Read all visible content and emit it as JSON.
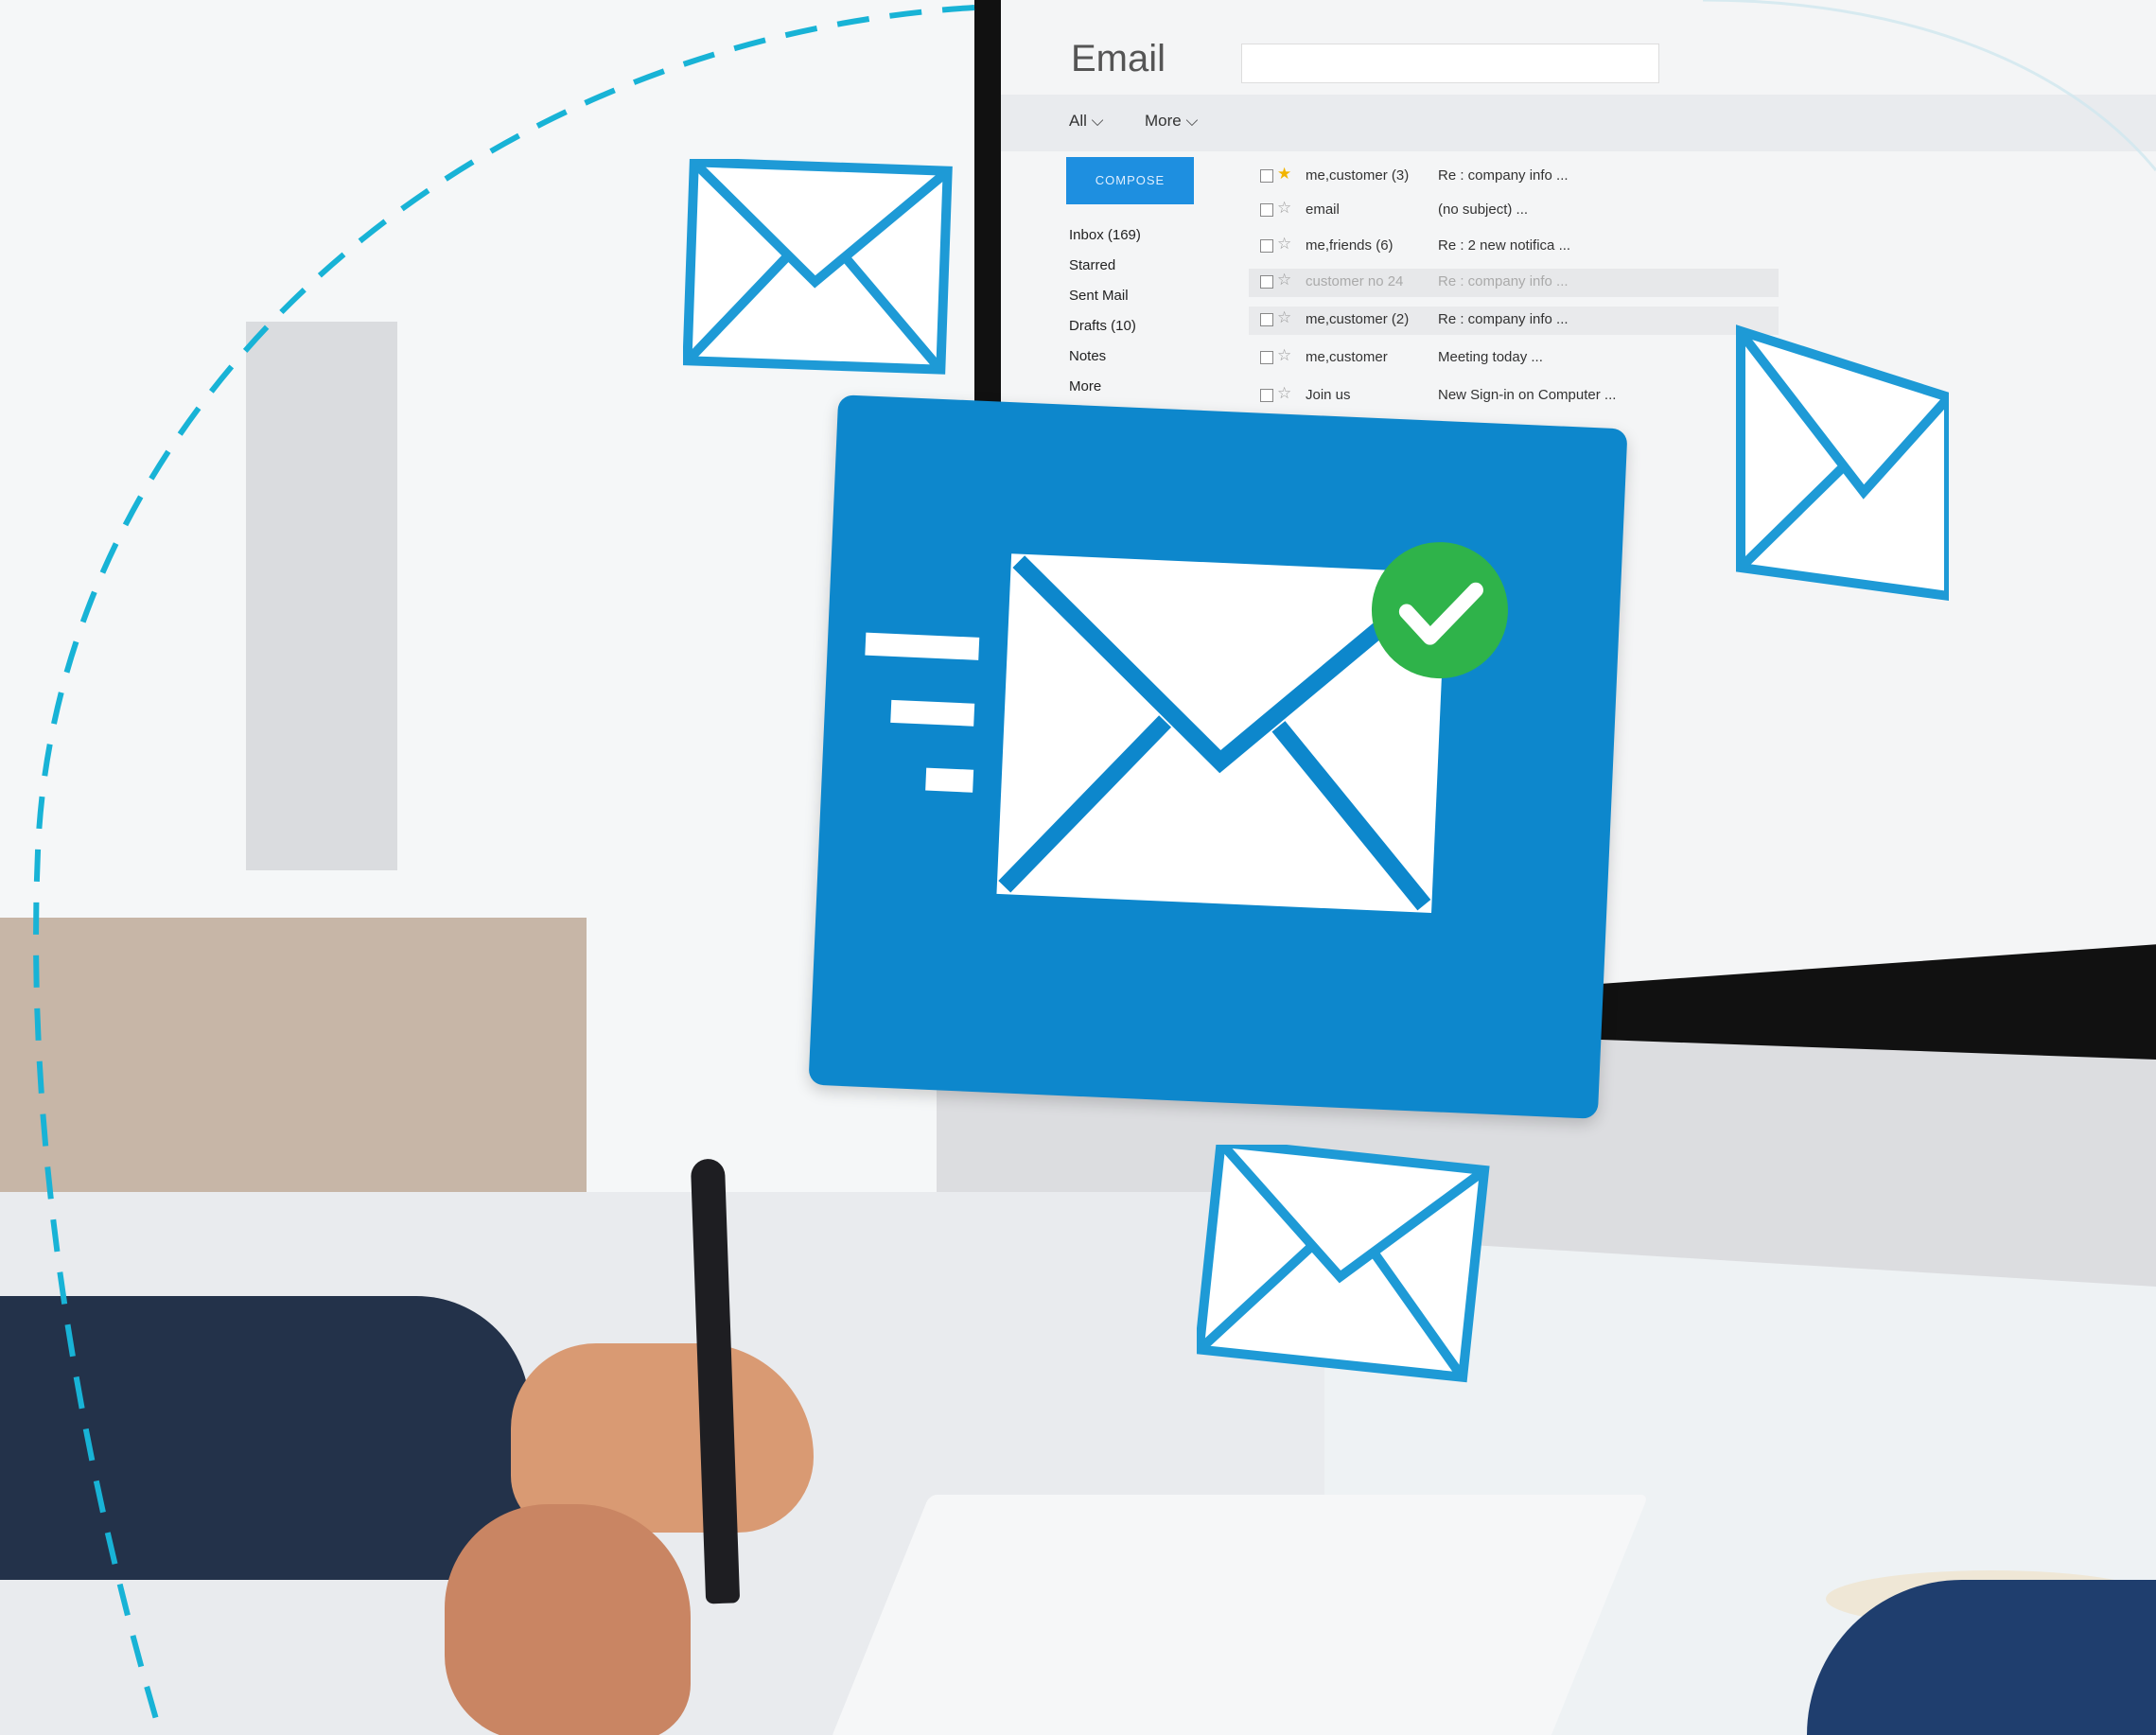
{
  "email_app": {
    "title": "Email",
    "toolbar": {
      "all": "All ⌵",
      "more": "More ⌵"
    },
    "compose_label": "COMPOSE",
    "folders": [
      {
        "label": "Inbox (169)"
      },
      {
        "label": "Starred"
      },
      {
        "label": "Sent Mail"
      },
      {
        "label": "Drafts (10)"
      },
      {
        "label": "Notes"
      },
      {
        "label": "More"
      }
    ],
    "messages": [
      {
        "from": "me,customer (3)",
        "subject": "Re : company info ...",
        "starred": true
      },
      {
        "from": "email",
        "subject": "(no subject) ..."
      },
      {
        "from": "me,friends (6)",
        "subject": "Re : 2 new notifica ..."
      },
      {
        "from": "customer no 24",
        "subject": "Re : company info ...",
        "dim": true
      },
      {
        "from": "me,customer (2)",
        "subject": "Re : company info ..."
      },
      {
        "from": "me,customer",
        "subject": "Meeting today ..."
      },
      {
        "from": "Join us",
        "subject": "New Sign-in on Computer ..."
      }
    ]
  },
  "colors": {
    "accent": "#0d87cc",
    "check": "#2fb34a",
    "outline": "#1e9ad6",
    "arc": "#18b3d6"
  },
  "icons": [
    "envelope-icon",
    "check-icon",
    "speed-lines-icon"
  ]
}
